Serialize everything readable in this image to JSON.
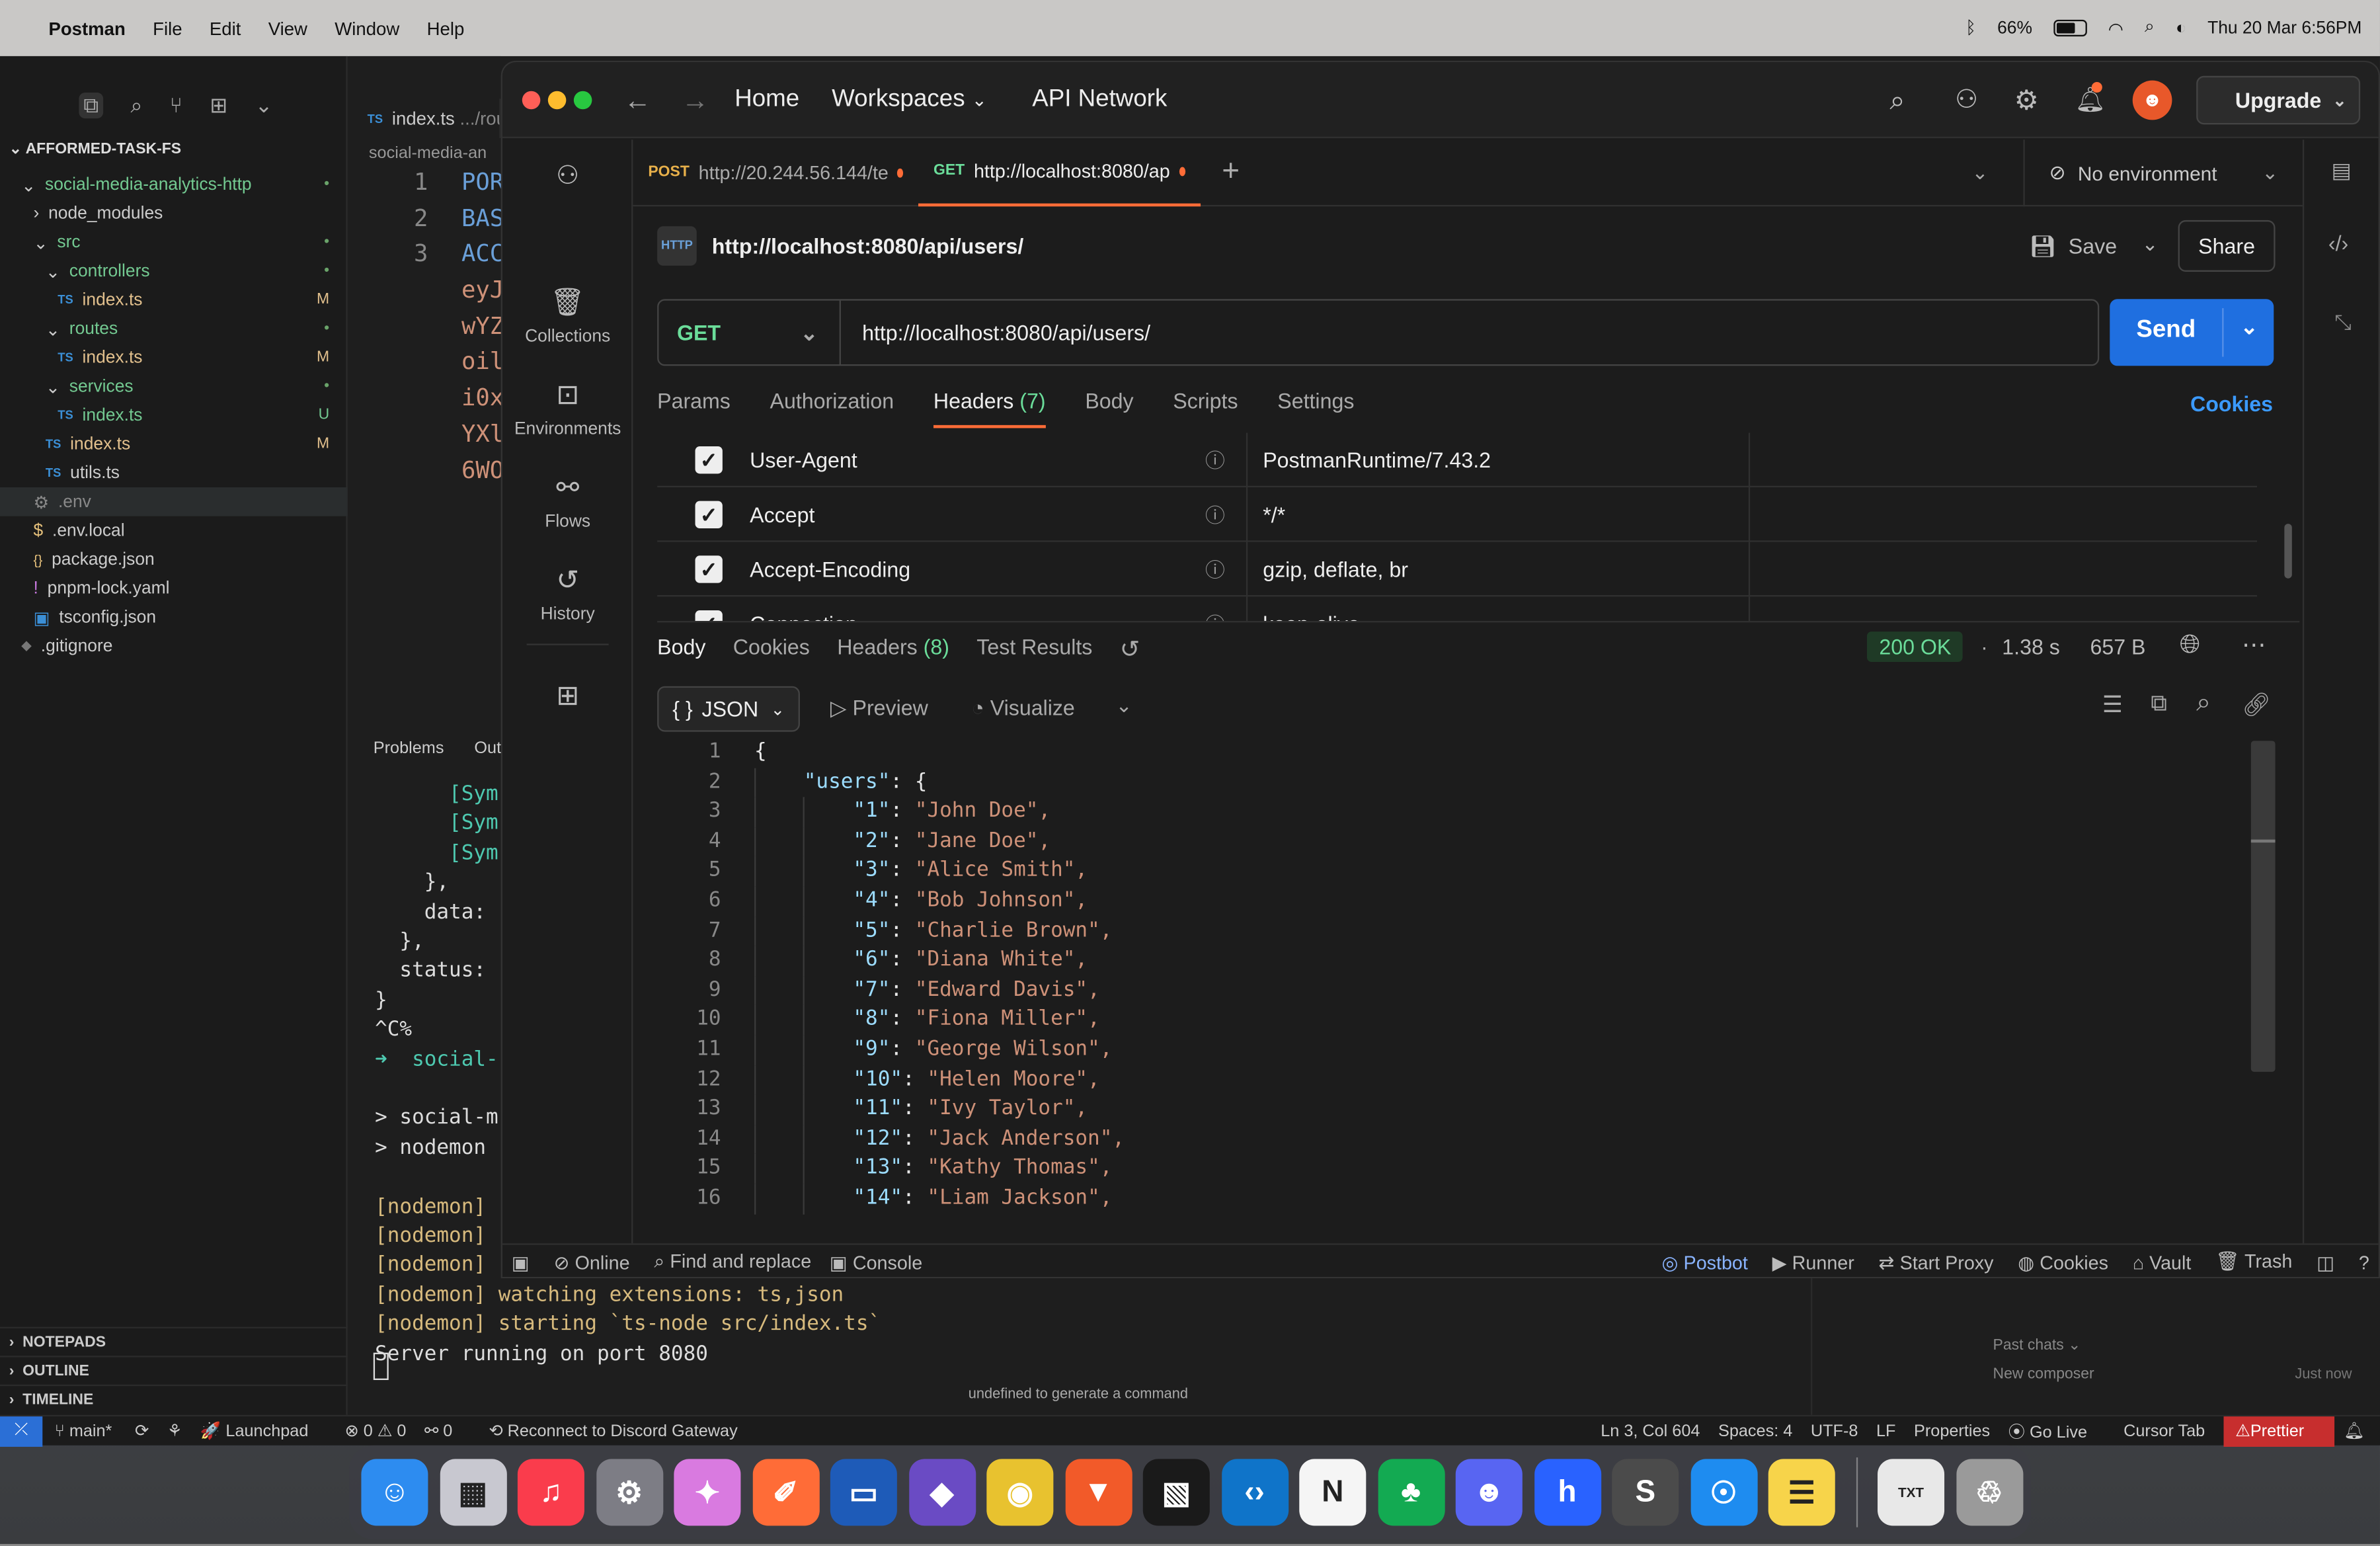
{
  "menubar": {
    "app": "Postman",
    "menus": [
      "File",
      "Edit",
      "View",
      "Window",
      "Help"
    ],
    "battery": "66%",
    "battery_level": 0.66,
    "datetime": "Thu 20 Mar  6:56PM"
  },
  "vscode": {
    "project": "AFFORMED-TASK-FS",
    "tab": "index.ts",
    "tab_path": ".../rou",
    "breadcrumb": "social-media-an",
    "tree": [
      {
        "label": "social-media-analytics-http",
        "indent": 0,
        "kind": "folder-open",
        "mark": "•"
      },
      {
        "label": "node_modules",
        "indent": 1,
        "kind": "folder",
        "mark": ""
      },
      {
        "label": "src",
        "indent": 1,
        "kind": "folder-open",
        "mark": "•"
      },
      {
        "label": "controllers",
        "indent": 2,
        "kind": "folder-open",
        "mark": "•"
      },
      {
        "label": "index.ts",
        "indent": 3,
        "kind": "ts",
        "mark": "M"
      },
      {
        "label": "routes",
        "indent": 2,
        "kind": "folder-open",
        "mark": "•"
      },
      {
        "label": "index.ts",
        "indent": 3,
        "kind": "ts",
        "mark": "M"
      },
      {
        "label": "services",
        "indent": 2,
        "kind": "folder-open",
        "mark": "•"
      },
      {
        "label": "index.ts",
        "indent": 3,
        "kind": "ts",
        "mark": "U"
      },
      {
        "label": "index.ts",
        "indent": 2,
        "kind": "ts",
        "mark": "M"
      },
      {
        "label": "utils.ts",
        "indent": 2,
        "kind": "ts",
        "mark": ""
      },
      {
        "label": ".env",
        "indent": 1,
        "kind": "env",
        "mark": ""
      },
      {
        "label": ".env.local",
        "indent": 1,
        "kind": "dollar",
        "mark": ""
      },
      {
        "label": "package.json",
        "indent": 1,
        "kind": "json",
        "mark": ""
      },
      {
        "label": "pnpm-lock.yaml",
        "indent": 1,
        "kind": "yaml",
        "mark": ""
      },
      {
        "label": "tsconfig.json",
        "indent": 1,
        "kind": "tsconfig",
        "mark": ""
      },
      {
        "label": ".gitignore",
        "indent": 0,
        "kind": "git",
        "mark": ""
      }
    ],
    "sections": [
      "NOTEPADS",
      "OUTLINE",
      "TIMELINE"
    ],
    "editor_lines": [
      {
        "n": "1",
        "t": "POR"
      },
      {
        "n": "2",
        "t": "BAS"
      },
      {
        "n": "3",
        "t": "ACC"
      },
      {
        "n": "",
        "t": "eyJ"
      },
      {
        "n": "",
        "t": "wYZ"
      },
      {
        "n": "",
        "t": "oil"
      },
      {
        "n": "",
        "t": "i0x"
      },
      {
        "n": "",
        "t": "YXl"
      },
      {
        "n": "",
        "t": "6WO"
      }
    ],
    "panel_tabs": [
      "Problems",
      "Out"
    ],
    "terminal": [
      "      [Sym",
      "      [Sym",
      "      [Sym",
      "    },",
      "    data: ",
      "  },",
      "  status: ",
      "}",
      "^C%",
      "➜  social-",
      "",
      "> social-m",
      "> nodemon ",
      "",
      "[nodemon] ",
      "[nodemon] ",
      "[nodemon] ",
      "[nodemon] watching extensions: ts,json",
      "[nodemon] starting `ts-node src/index.ts`",
      "Server running on port 8080"
    ],
    "terminal_hint": "undefined to generate a command",
    "chat_past": "Past chats",
    "chat_new": "New composer",
    "chat_time": "Just now",
    "status": {
      "branch": "main*",
      "launchpad": "Launchpad",
      "problems": "⊗ 0 ⚠ 0",
      "ports": "0",
      "discord": "Reconnect to Discord Gateway",
      "position": "Ln 3, Col 604",
      "spaces": "Spaces: 4",
      "encoding": "UTF-8",
      "eol": "LF",
      "props": "Properties",
      "golive": "Go Live",
      "cursortab": "Cursor Tab",
      "prettier": "Prettier"
    }
  },
  "postman": {
    "nav": {
      "home": "Home",
      "workspaces": "Workspaces",
      "api_network": "API Network",
      "upgrade": "Upgrade"
    },
    "sidebar": [
      "Collections",
      "Environments",
      "Flows",
      "History"
    ],
    "tabs": [
      {
        "method": "POST",
        "url": "http://20.244.56.144/te"
      },
      {
        "method": "GET",
        "url": "http://localhost:8080/ap"
      }
    ],
    "environment": "No environment",
    "request_title": "http://localhost:8080/api/users/",
    "save": "Save",
    "share": "Share",
    "method": "GET",
    "url": "http://localhost:8080/api/users/",
    "send": "Send",
    "req_tabs": [
      "Params",
      "Authorization",
      "Headers",
      "Body",
      "Scripts",
      "Settings"
    ],
    "headers_count": "(7)",
    "cookies": "Cookies",
    "headers": [
      {
        "key": "User-Agent",
        "value": "PostmanRuntime/7.43.2"
      },
      {
        "key": "Accept",
        "value": "*/*"
      },
      {
        "key": "Accept-Encoding",
        "value": "gzip, deflate, br"
      },
      {
        "key": "Connection",
        "value": "keep-alive"
      }
    ],
    "resp_tabs": [
      "Body",
      "Cookies",
      "Headers",
      "Test Results"
    ],
    "resp_headers_count": "(8)",
    "status": "200 OK",
    "time": "1.38 s",
    "size": "657 B",
    "format": "JSON",
    "preview": "Preview",
    "visualize": "Visualize",
    "body_lines": [
      {
        "n": "1",
        "indent": 0,
        "raw": "{"
      },
      {
        "n": "2",
        "indent": 1,
        "key": "users",
        "raw": ": {"
      },
      {
        "n": "3",
        "indent": 2,
        "key": "1",
        "val": "John Doe"
      },
      {
        "n": "4",
        "indent": 2,
        "key": "2",
        "val": "Jane Doe"
      },
      {
        "n": "5",
        "indent": 2,
        "key": "3",
        "val": "Alice Smith"
      },
      {
        "n": "6",
        "indent": 2,
        "key": "4",
        "val": "Bob Johnson"
      },
      {
        "n": "7",
        "indent": 2,
        "key": "5",
        "val": "Charlie Brown"
      },
      {
        "n": "8",
        "indent": 2,
        "key": "6",
        "val": "Diana White"
      },
      {
        "n": "9",
        "indent": 2,
        "key": "7",
        "val": "Edward Davis"
      },
      {
        "n": "10",
        "indent": 2,
        "key": "8",
        "val": "Fiona Miller"
      },
      {
        "n": "11",
        "indent": 2,
        "key": "9",
        "val": "George Wilson"
      },
      {
        "n": "12",
        "indent": 2,
        "key": "10",
        "val": "Helen Moore"
      },
      {
        "n": "13",
        "indent": 2,
        "key": "11",
        "val": "Ivy Taylor"
      },
      {
        "n": "14",
        "indent": 2,
        "key": "12",
        "val": "Jack Anderson"
      },
      {
        "n": "15",
        "indent": 2,
        "key": "13",
        "val": "Kathy Thomas"
      },
      {
        "n": "16",
        "indent": 2,
        "key": "14",
        "val": "Liam Jackson"
      }
    ],
    "footer": [
      "Online",
      "Find and replace",
      "Console"
    ],
    "footer_right": [
      "Postbot",
      "Runner",
      "Start Proxy",
      "Cookies",
      "Vault",
      "Trash"
    ]
  },
  "dock": [
    {
      "name": "Finder",
      "color": "#2d8cf0",
      "glyph": "☺"
    },
    {
      "name": "Launchpad",
      "color": "#c8c8d0",
      "glyph": "▦"
    },
    {
      "name": "Music",
      "color": "#fa3c4c",
      "glyph": "♫"
    },
    {
      "name": "System Settings",
      "color": "#7d7d85",
      "glyph": "⚙"
    },
    {
      "name": "Perplexity",
      "color": "#d97ae0",
      "glyph": "✦"
    },
    {
      "name": "Postman",
      "color": "#ff6c37",
      "glyph": "✐"
    },
    {
      "name": "Windows App",
      "color": "#1e5bb8",
      "glyph": "▭"
    },
    {
      "name": "Obsidian",
      "color": "#6a4bc4",
      "glyph": "◆"
    },
    {
      "name": "Chrome",
      "color": "#e8c22f",
      "glyph": "◉"
    },
    {
      "name": "Brave",
      "color": "#f25a29",
      "glyph": "▼"
    },
    {
      "name": "Cursor",
      "color": "#1a1a1a",
      "glyph": "▧"
    },
    {
      "name": "VS Code",
      "color": "#0f74c9",
      "glyph": "‹›"
    },
    {
      "name": "Notion",
      "color": "#f5f5f5",
      "glyph": "N"
    },
    {
      "name": "MongoDB Compass",
      "color": "#13aa52",
      "glyph": "♣"
    },
    {
      "name": "Discord",
      "color": "#5865f2",
      "glyph": "☻"
    },
    {
      "name": "Hashnode",
      "color": "#2962ff",
      "glyph": "h"
    },
    {
      "name": "Sublime Text",
      "color": "#4b4b4b",
      "glyph": "S"
    },
    {
      "name": "Safari",
      "color": "#1e8cf0",
      "glyph": "☉"
    },
    {
      "name": "Notes",
      "color": "#f7d44a",
      "glyph": "☰"
    },
    {
      "name": "Text File",
      "color": "#e8e8e8",
      "glyph": "TXT"
    },
    {
      "name": "Trash",
      "color": "#9a9a9a",
      "glyph": "♲"
    }
  ]
}
